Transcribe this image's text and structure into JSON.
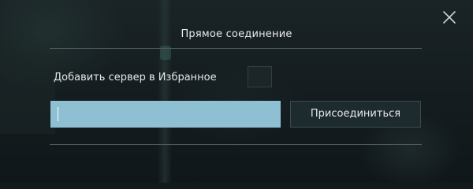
{
  "dialog": {
    "title": "Прямое соединение",
    "close_icon": "close-icon"
  },
  "favorite": {
    "label": "Добавить сервер в Избранное",
    "checked": false
  },
  "address": {
    "value": "",
    "placeholder": ""
  },
  "connect": {
    "label": "Присоединиться"
  },
  "colors": {
    "input_background": "#8fbfd3",
    "button_background": "#1d2a2e",
    "divider": "#4a5a60",
    "text": "#e6eaea"
  }
}
